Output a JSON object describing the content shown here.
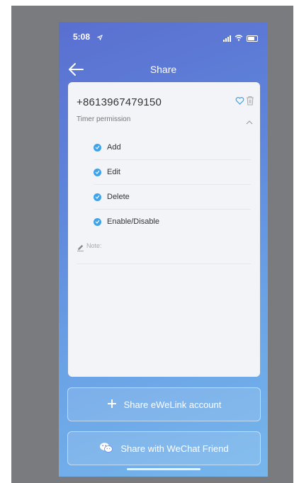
{
  "status_bar": {
    "time": "5:08"
  },
  "header": {
    "title": "Share"
  },
  "share_card": {
    "phone": "+8613967479150",
    "permission_label": "Timer permission",
    "permissions": [
      {
        "label": "Add",
        "checked": true
      },
      {
        "label": "Edit",
        "checked": true
      },
      {
        "label": "Delete",
        "checked": true
      },
      {
        "label": "Enable/Disable",
        "checked": true
      }
    ],
    "note_label": "Note:"
  },
  "actions": {
    "share_ewelink": "Share eWeLink account",
    "share_wechat": "Share with WeChat Friend"
  },
  "colors": {
    "check": "#3fa3e8",
    "gradient_top": "#5a6fd0",
    "gradient_bottom": "#76b6ec"
  }
}
